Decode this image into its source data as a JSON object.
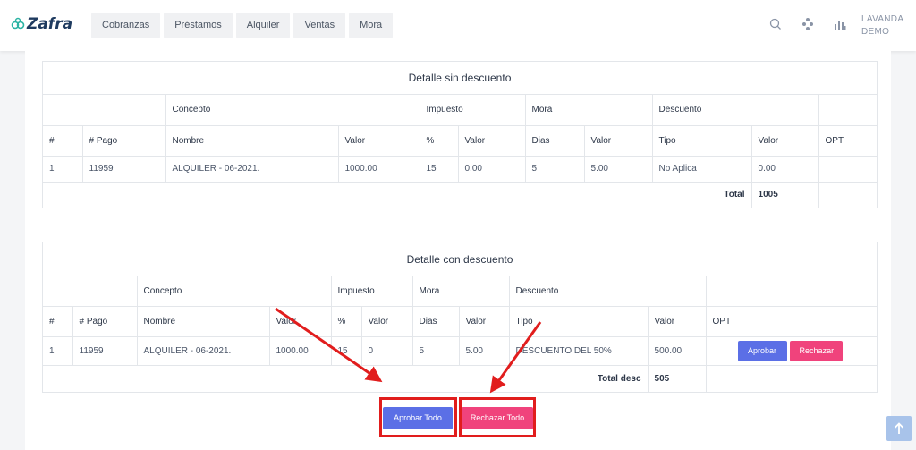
{
  "app": {
    "logo_text": "Zafra"
  },
  "nav": [
    {
      "label": "Cobranzas"
    },
    {
      "label": "Préstamos"
    },
    {
      "label": "Alquiler"
    },
    {
      "label": "Ventas"
    },
    {
      "label": "Mora"
    }
  ],
  "user": {
    "line1": "LAVANDA",
    "line2": "DEMO"
  },
  "icons": {
    "search": "search-icon",
    "apps": "apps-icon",
    "stats": "bar-chart-icon",
    "scroll_top": "arrow-up-icon"
  },
  "colors": {
    "approve": "#5b6fe6",
    "reject": "#f0437c",
    "annotation": "#e11d1d"
  },
  "detalle_sin": {
    "title": "Detalle sin descuento",
    "groups": {
      "concepto": "Concepto",
      "impuesto": "Impuesto",
      "mora": "Mora",
      "descuento": "Descuento"
    },
    "cols": {
      "num": "#",
      "pago": "# Pago",
      "nombre": "Nombre",
      "valor": "Valor",
      "pct": "%",
      "imp_valor": "Valor",
      "dias": "Dias",
      "mora_valor": "Valor",
      "tipo": "Tipo",
      "desc_valor": "Valor",
      "opt": "OPT"
    },
    "row": {
      "num": "1",
      "pago": "11959",
      "nombre": "ALQUILER - 06-2021.",
      "valor": "1000.00",
      "pct": "15",
      "imp_valor": "0.00",
      "dias": "5",
      "mora_valor": "5.00",
      "tipo": "No Aplica",
      "desc_valor": "0.00"
    },
    "total_label": "Total",
    "total_value": "1005"
  },
  "detalle_con": {
    "title": "Detalle con descuento",
    "groups": {
      "concepto": "Concepto",
      "impuesto": "Impuesto",
      "mora": "Mora",
      "descuento": "Descuento"
    },
    "cols": {
      "num": "#",
      "pago": "# Pago",
      "nombre": "Nombre",
      "valor": "Valor",
      "pct": "%",
      "imp_valor": "Valor",
      "dias": "Dias",
      "mora_valor": "Valor",
      "tipo": "Tipo",
      "desc_valor": "Valor",
      "opt": "OPT"
    },
    "row": {
      "num": "1",
      "pago": "11959",
      "nombre": "ALQUILER - 06-2021.",
      "valor": "1000.00",
      "pct": "15",
      "imp_valor": "0",
      "dias": "5",
      "mora_valor": "5.00",
      "tipo": "DESCUENTO DEL 50%",
      "desc_valor": "500.00",
      "approve": "Aprobar",
      "reject": "Rechazar"
    },
    "total_label": "Total desc",
    "total_value": "505"
  },
  "actions": {
    "approve_all": "Aprobar Todo",
    "reject_all": "Rechazar Todo"
  }
}
